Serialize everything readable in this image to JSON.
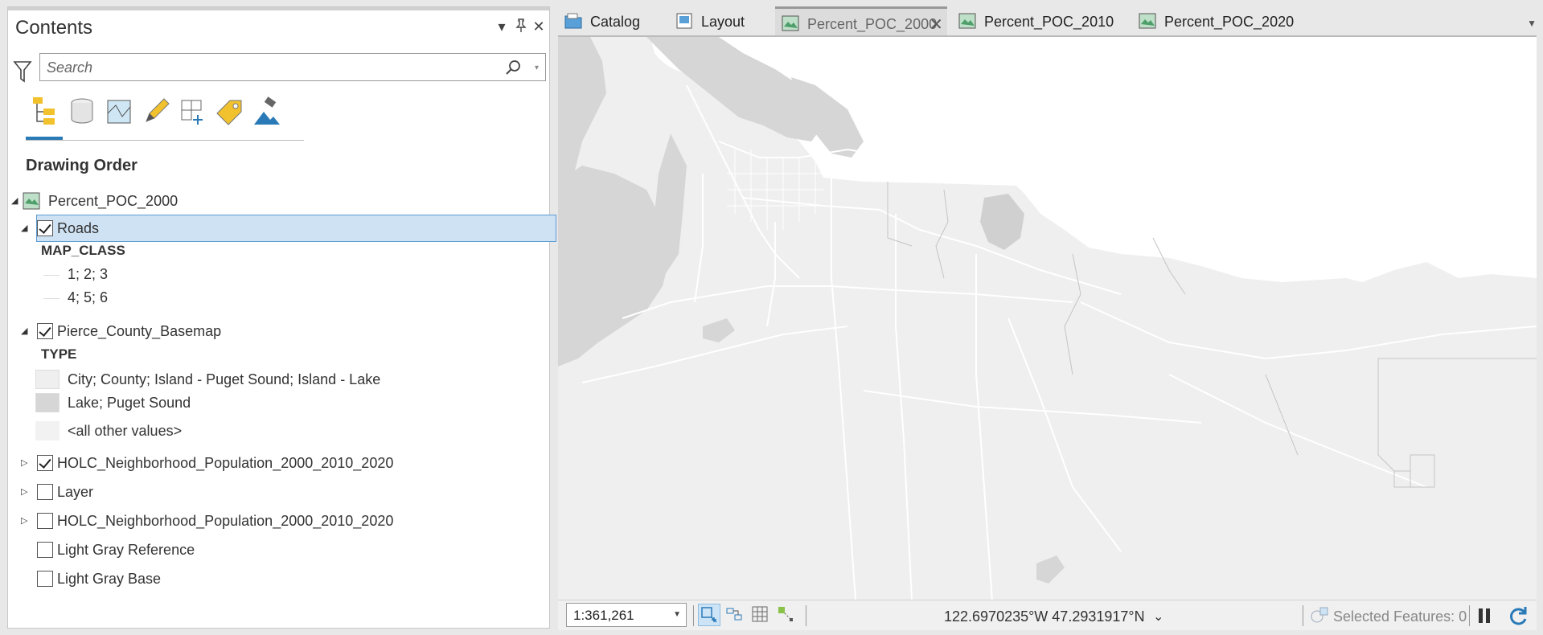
{
  "contents": {
    "title": "Contents",
    "search_placeholder": "Search",
    "drawing_order": "Drawing Order",
    "map_name": "Percent_POC_2000",
    "layers": [
      {
        "label": "Roads",
        "checked": true
      },
      {
        "label": "Pierce_County_Basemap",
        "checked": true
      },
      {
        "label": "HOLC_Neighborhood_Population_2000_2010_2020",
        "checked": true
      },
      {
        "label": "Layer",
        "checked": false
      },
      {
        "label": "HOLC_Neighborhood_Population_2000_2010_2020",
        "checked": false
      },
      {
        "label": "Light Gray Reference",
        "checked": false
      },
      {
        "label": "Light Gray Base",
        "checked": false
      }
    ],
    "roads_legend": {
      "field": "MAP_CLASS",
      "classes": [
        "1; 2; 3",
        "4; 5; 6"
      ]
    },
    "basemap_legend": {
      "field": "TYPE",
      "classes": [
        {
          "label": "City; County; Island - Puget Sound; Island - Lake",
          "color": "#efefef"
        },
        {
          "label": "Lake; Puget Sound",
          "color": "#d6d6d6"
        },
        {
          "label": "<all other values>",
          "color": "#f2f2f2"
        }
      ]
    },
    "toolbar_icons": [
      "list-by-drawing-order-icon",
      "list-by-source-icon",
      "list-by-selection-icon",
      "list-by-editing-icon",
      "list-by-snapping-icon",
      "list-by-labeling-icon",
      "list-by-perspective-imagery-icon"
    ]
  },
  "tabs": [
    {
      "label": "Catalog",
      "active": false
    },
    {
      "label": "Layout",
      "active": false
    },
    {
      "label": "Percent_POC_2000",
      "active": true
    },
    {
      "label": "Percent_POC_2010",
      "active": false
    },
    {
      "label": "Percent_POC_2020",
      "active": false
    }
  ],
  "status": {
    "scale": "1:361,261",
    "coordinates": "122.6970235°W 47.2931917°N",
    "selected_features": "Selected Features: 0"
  },
  "colors": {
    "accent": "#2a7ab8",
    "selection": "#cfe2f3",
    "water": "#d6d6d6",
    "land": "#efefef"
  }
}
